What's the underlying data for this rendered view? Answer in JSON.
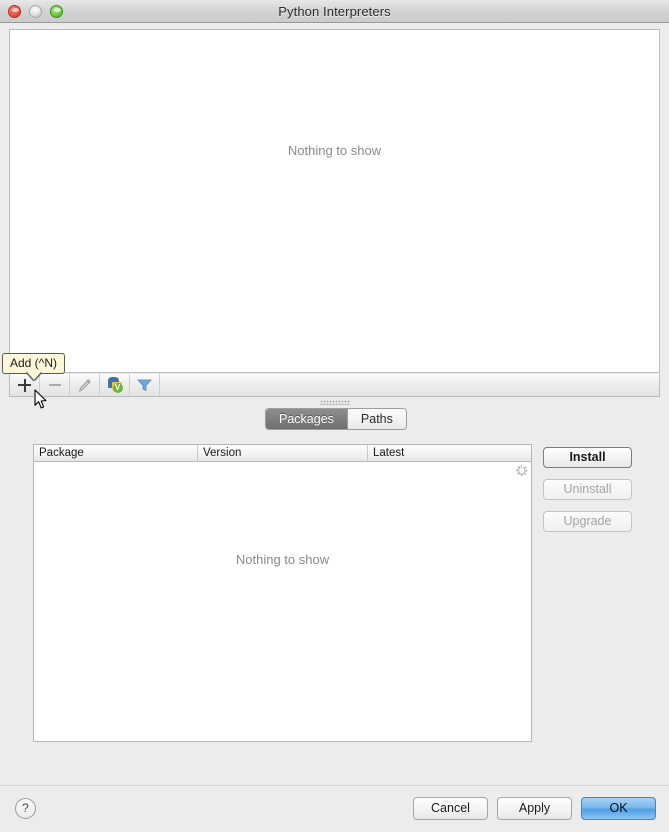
{
  "window": {
    "title": "Python Interpreters",
    "traffic_lights": [
      {
        "name": "close",
        "color": "#e2483d"
      },
      {
        "name": "minimize",
        "color": "#d8d8d8"
      },
      {
        "name": "zoom",
        "color": "#60c13c"
      }
    ]
  },
  "interpreter_panel": {
    "empty_text": "Nothing to show"
  },
  "toolbar": {
    "buttons": [
      {
        "name": "add",
        "icon": "plus-icon",
        "enabled": true
      },
      {
        "name": "remove",
        "icon": "minus-icon",
        "enabled": false
      },
      {
        "name": "edit",
        "icon": "pencil-icon",
        "enabled": false
      },
      {
        "name": "show-paths",
        "icon": "python-env-icon",
        "enabled": true
      },
      {
        "name": "filter",
        "icon": "funnel-icon",
        "enabled": true
      }
    ]
  },
  "tooltip": {
    "text": "Add (^N)",
    "background": "#fbf7d8",
    "border": "#5b5b4a"
  },
  "tabs": [
    {
      "label": "Packages",
      "active": true
    },
    {
      "label": "Paths",
      "active": false
    }
  ],
  "packages": {
    "columns": [
      "Package",
      "Version",
      "Latest"
    ],
    "rows": [],
    "empty_text": "Nothing to show",
    "loading": true,
    "actions": [
      {
        "label": "Install",
        "enabled": true,
        "default": true
      },
      {
        "label": "Uninstall",
        "enabled": false,
        "default": false
      },
      {
        "label": "Upgrade",
        "enabled": false,
        "default": false
      }
    ]
  },
  "footer": {
    "help_label": "?",
    "buttons": [
      {
        "label": "Cancel",
        "default": false
      },
      {
        "label": "Apply",
        "default": false
      },
      {
        "label": "OK",
        "default": true
      }
    ],
    "default_accent": "#4f9ee6"
  }
}
